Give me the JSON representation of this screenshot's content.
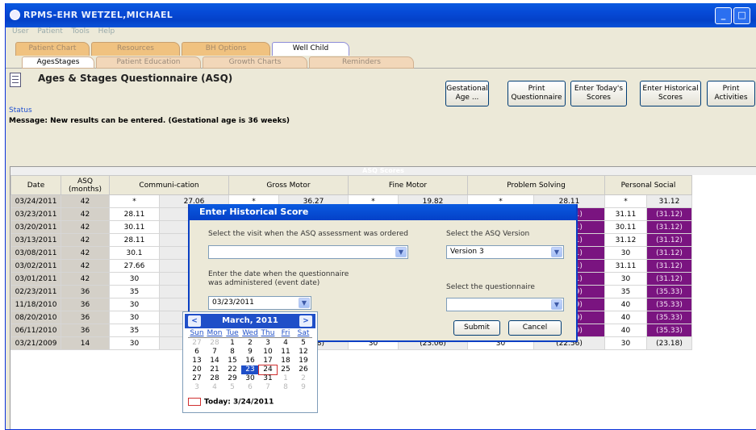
{
  "app": {
    "title": "RPMS-EHR WETZEL,MICHAEL",
    "minimize_icon": "minimize-icon",
    "maximize_icon": "maximize-icon"
  },
  "menu": [
    "User",
    "Patient",
    "Tools",
    "Help"
  ],
  "main_tabs": [
    "Patient Chart",
    "Resources",
    "BH Options",
    "Well Child"
  ],
  "sub_tabs": [
    "AgesStages",
    "Patient Education",
    "Growth Charts",
    "Reminders"
  ],
  "header": {
    "title": "Ages & Stages Questionnaire (ASQ)",
    "status_label": "Status",
    "message": "Message:  New results can be entered. (Gestational age is 36 weeks)"
  },
  "toolbar": {
    "gestational_age": "Gestational Age ...",
    "print_questionnaire": "Print Questionnaire",
    "enter_todays_scores": "Enter Today's Scores",
    "enter_historical_scores": "Enter Historical Scores",
    "print_activities": "Print Activities"
  },
  "grid": {
    "banner": "ASQ Scores",
    "headers": [
      "Date",
      "ASQ (months)",
      "Communi-cation",
      "",
      "Gross Motor",
      "",
      "Fine Motor",
      "",
      "Problem Solving",
      "",
      "Personal Social",
      ""
    ],
    "rows": [
      [
        "03/24/2011",
        "42",
        "*",
        "27.06",
        "*",
        "36.27",
        "*",
        "19.82",
        "*",
        "28.11",
        "*",
        "31.12"
      ],
      [
        "03/23/2011",
        "42",
        "28.11",
        "",
        "",
        "",
        "",
        "",
        "",
        "(28.11)",
        "31.11",
        "(31.12)"
      ],
      [
        "03/20/2011",
        "42",
        "30.11",
        "",
        "",
        "",
        "",
        "",
        "",
        "(28.11)",
        "30.11",
        "(31.12)"
      ],
      [
        "03/13/2011",
        "42",
        "28.11",
        "",
        "",
        "",
        "",
        "",
        "",
        "(28.11)",
        "31.12",
        "(31.12)"
      ],
      [
        "03/08/2011",
        "42",
        "30.1",
        "",
        "",
        "",
        "",
        "",
        "",
        "(28.11)",
        "30",
        "(31.12)"
      ],
      [
        "03/02/2011",
        "42",
        "27.66",
        "",
        "",
        "",
        "",
        "",
        "",
        "(28.11)",
        "31.11",
        "(31.12)"
      ],
      [
        "03/01/2011",
        "42",
        "30",
        "",
        "",
        "",
        "",
        "",
        "",
        "(28.11)",
        "30",
        "(31.12)"
      ],
      [
        "02/23/2011",
        "36",
        "35",
        "",
        "",
        "",
        "",
        "",
        "",
        "(30.29)",
        "35",
        "(35.33)"
      ],
      [
        "11/18/2010",
        "36",
        "30",
        "",
        "",
        "",
        "",
        "",
        "",
        "(30.29)",
        "40",
        "(35.33)"
      ],
      [
        "08/20/2010",
        "36",
        "30",
        "",
        "",
        "",
        "",
        "",
        "",
        "(30.29)",
        "40",
        "(35.33)"
      ],
      [
        "06/11/2010",
        "36",
        "35",
        "",
        "",
        "",
        "",
        "",
        "",
        "(30.29)",
        "40",
        "(35.33)"
      ],
      [
        "03/21/2009",
        "14",
        "30",
        "",
        "",
        "(25.8)",
        "30",
        "(23.06)",
        "30",
        "(22.56)",
        "30",
        "(23.18)"
      ]
    ]
  },
  "dialog": {
    "title": "Enter Historical Score",
    "visit_label": "Select the visit when the ASQ assessment was ordered",
    "visit_value": "",
    "version_label": "Select the ASQ Version",
    "version_value": "Version 3",
    "date_label": "Enter the date when the questionnaire was administered (event date)",
    "date_value": "03/23/2011",
    "questionnaire_label": "Select the questionnaire",
    "questionnaire_value": "",
    "submit": "Submit",
    "cancel": "Cancel"
  },
  "calendar": {
    "month": "March, 2011",
    "prev": "<",
    "next": ">",
    "dows": [
      "Sun",
      "Mon",
      "Tue",
      "Wed",
      "Thu",
      "Fri",
      "Sat"
    ],
    "weeks": [
      [
        "27",
        "28",
        "1",
        "2",
        "3",
        "4",
        "5"
      ],
      [
        "6",
        "7",
        "8",
        "9",
        "10",
        "11",
        "12"
      ],
      [
        "13",
        "14",
        "15",
        "16",
        "17",
        "18",
        "19"
      ],
      [
        "20",
        "21",
        "22",
        "23",
        "24",
        "25",
        "26"
      ],
      [
        "27",
        "28",
        "29",
        "30",
        "31",
        "1",
        "2"
      ],
      [
        "3",
        "4",
        "5",
        "6",
        "7",
        "8",
        "9"
      ]
    ],
    "selected": "23",
    "today_day": "24",
    "today": "Today: 3/24/2011",
    "colors": {
      "header": "#1f4fc8",
      "selected": "#1f4fc8",
      "today_ring": "#d03030",
      "other_month": "#b8b8b8"
    }
  }
}
